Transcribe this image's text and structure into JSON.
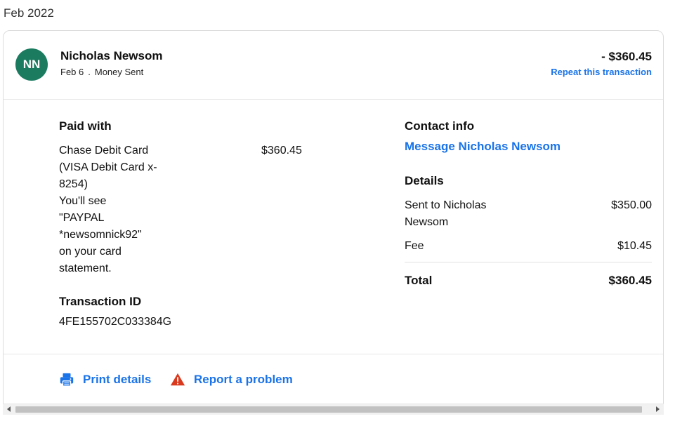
{
  "month_label": "Feb 2022",
  "transaction": {
    "avatar_initials": "NN",
    "name": "Nicholas Newsom",
    "date": "Feb 6",
    "separator": ".",
    "type": "Money Sent",
    "amount": "- $360.45",
    "repeat_label": "Repeat this transaction",
    "avatar_color": "#1b7b5f"
  },
  "paid_with": {
    "title": "Paid with",
    "lines": [
      "Chase Debit Card",
      "(VISA Debit Card x-",
      "8254)",
      "You'll see",
      "\"PAYPAL",
      "*newsomnick92\"",
      "on your card",
      "statement."
    ],
    "amount": "$360.45"
  },
  "transaction_id": {
    "title": "Transaction ID",
    "value": "4FE155702C033384G"
  },
  "contact": {
    "title": "Contact info",
    "message_label": "Message Nicholas Newsom"
  },
  "details": {
    "title": "Details",
    "rows": [
      {
        "label_line1": "Sent to Nicholas",
        "label_line2": "Newsom",
        "value": "$350.00"
      },
      {
        "label_line1": "Fee",
        "value": "$10.45"
      }
    ],
    "total_label": "Total",
    "total_value": "$360.45"
  },
  "actions": {
    "print_label": "Print details",
    "report_label": "Report a problem",
    "print_icon": "printer-icon",
    "report_icon": "warning-icon"
  },
  "colors": {
    "link": "#1a73e8",
    "warning": "#d93a1e",
    "avatar": "#1b7b5f"
  }
}
